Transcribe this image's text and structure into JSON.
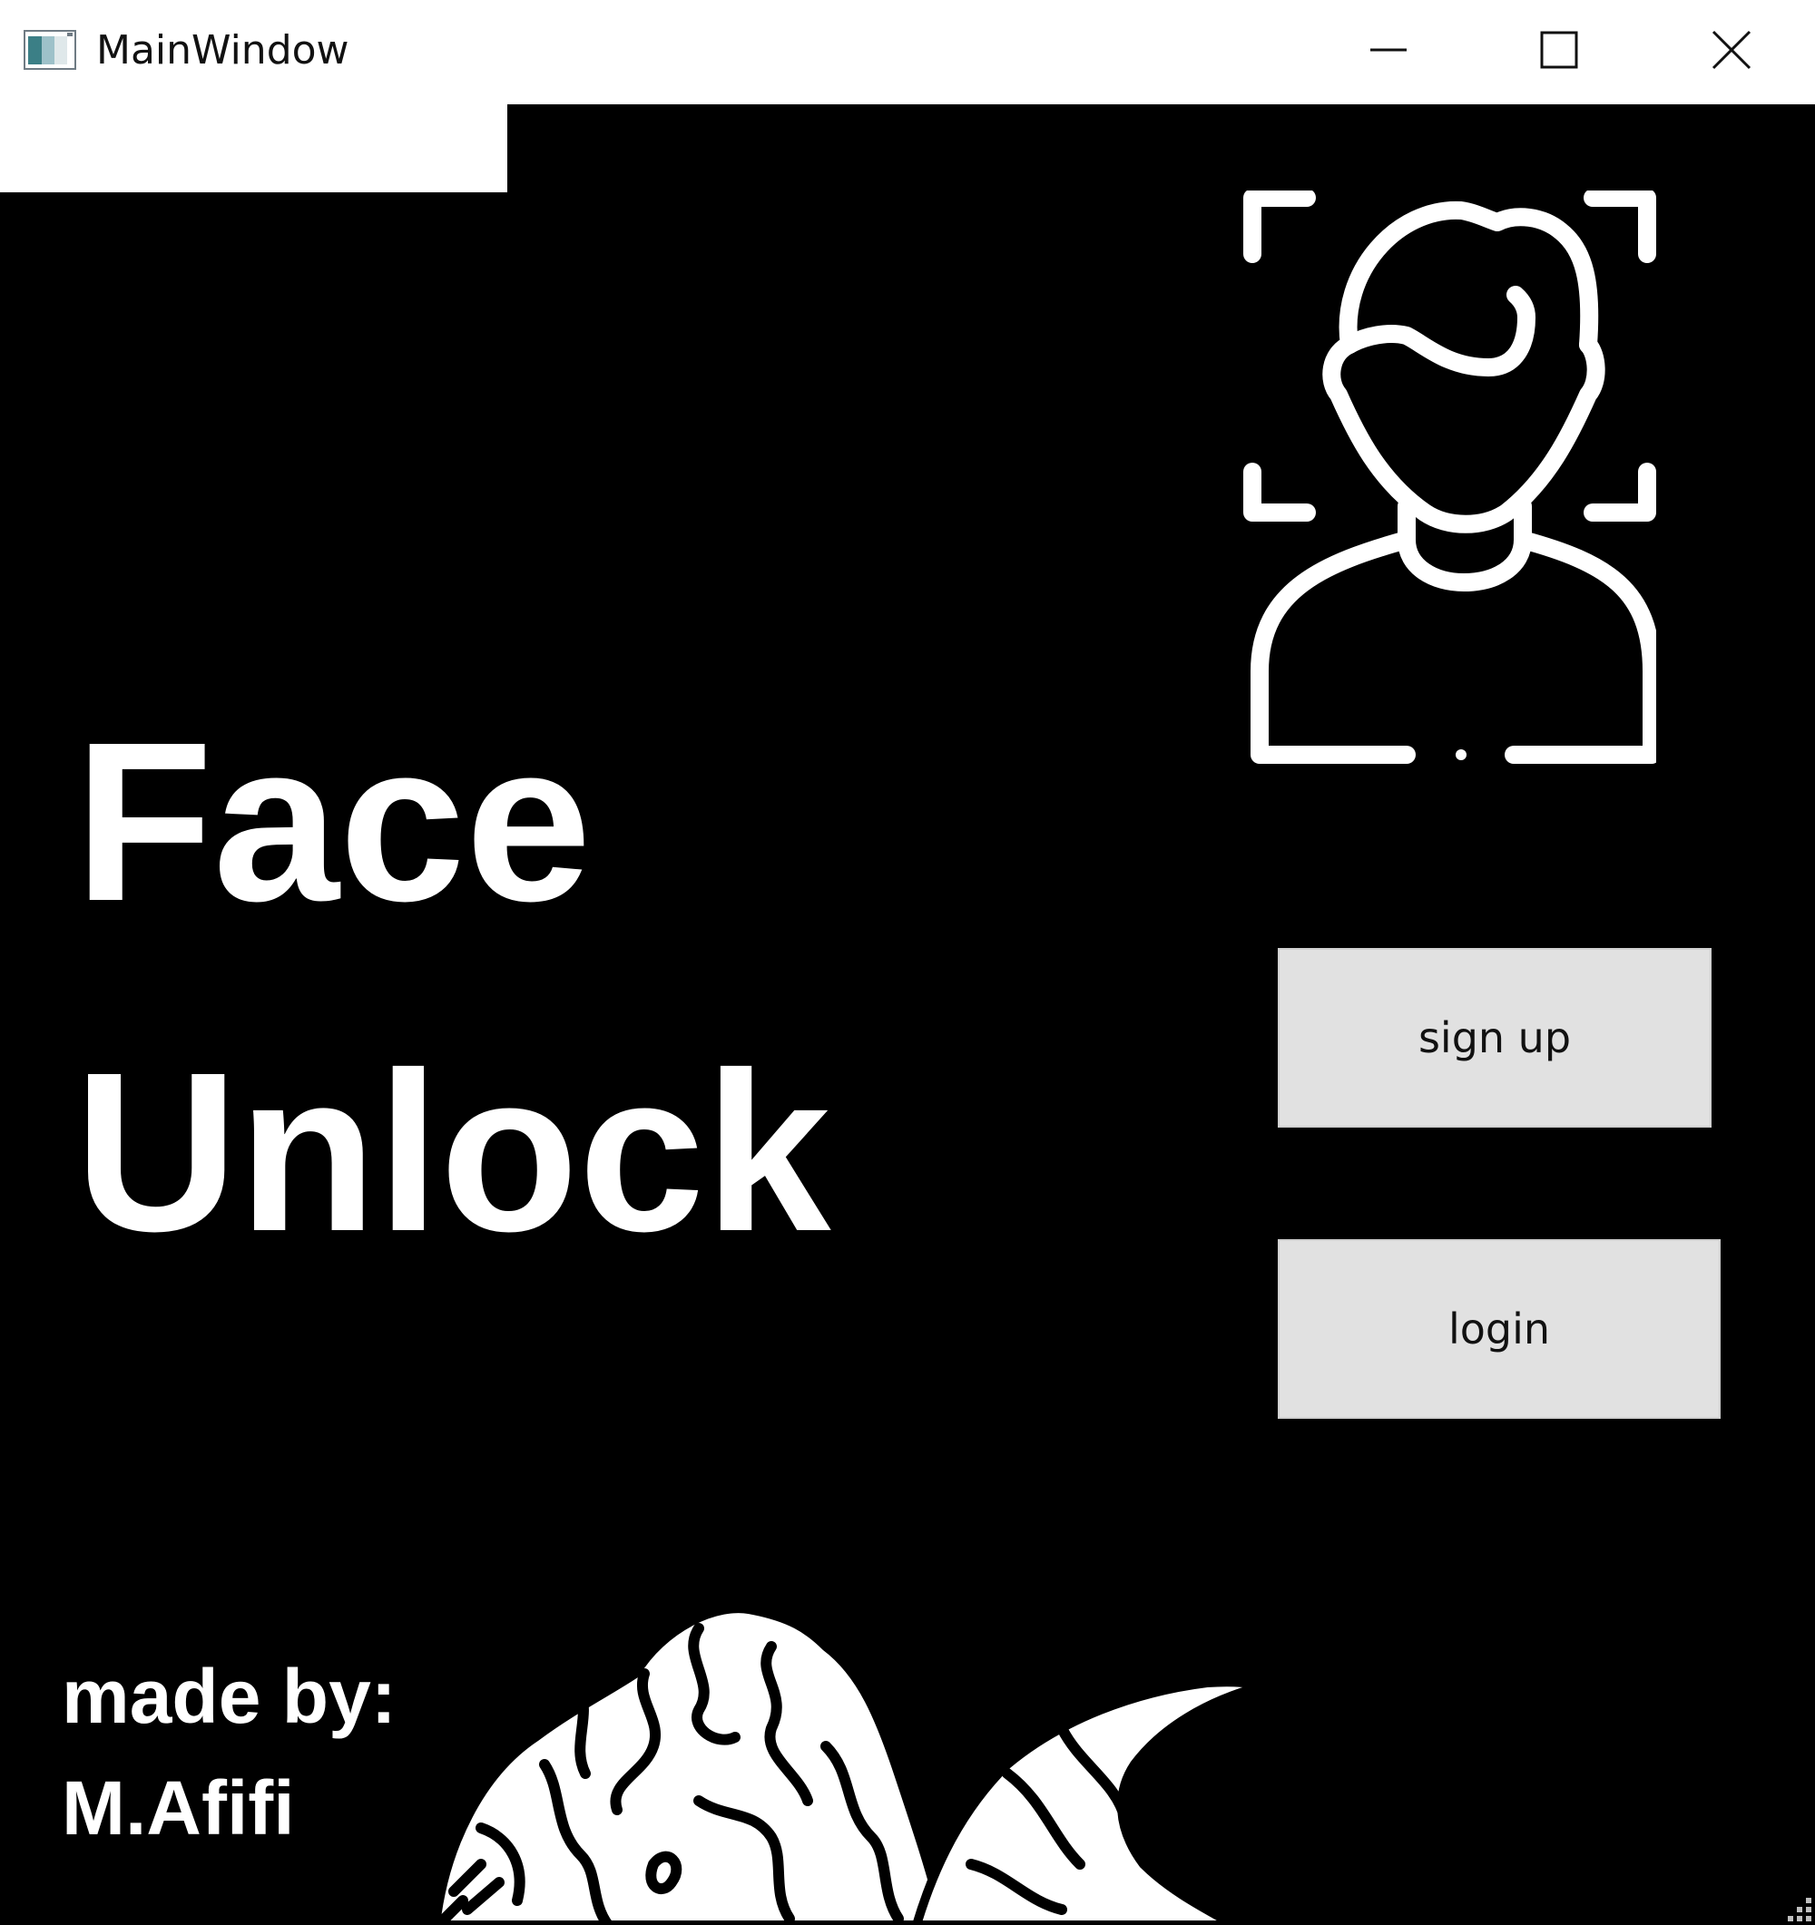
{
  "window": {
    "title": "MainWindow",
    "icon": "app-window-icon"
  },
  "title_bar_controls": {
    "minimize": "minimize-icon",
    "maximize": "maximize-icon",
    "close": "close-icon"
  },
  "main": {
    "headline_line1": "Face",
    "headline_line2": "Unlock",
    "face_icon": "face-recognition-icon",
    "buttons": {
      "signup_label": "sign up",
      "login_label": "login"
    },
    "credit_line1": "made by:",
    "credit_line2": "M.Afifi"
  },
  "colors": {
    "background": "#000000",
    "foreground": "#ffffff",
    "button": "#e1e1e1"
  }
}
